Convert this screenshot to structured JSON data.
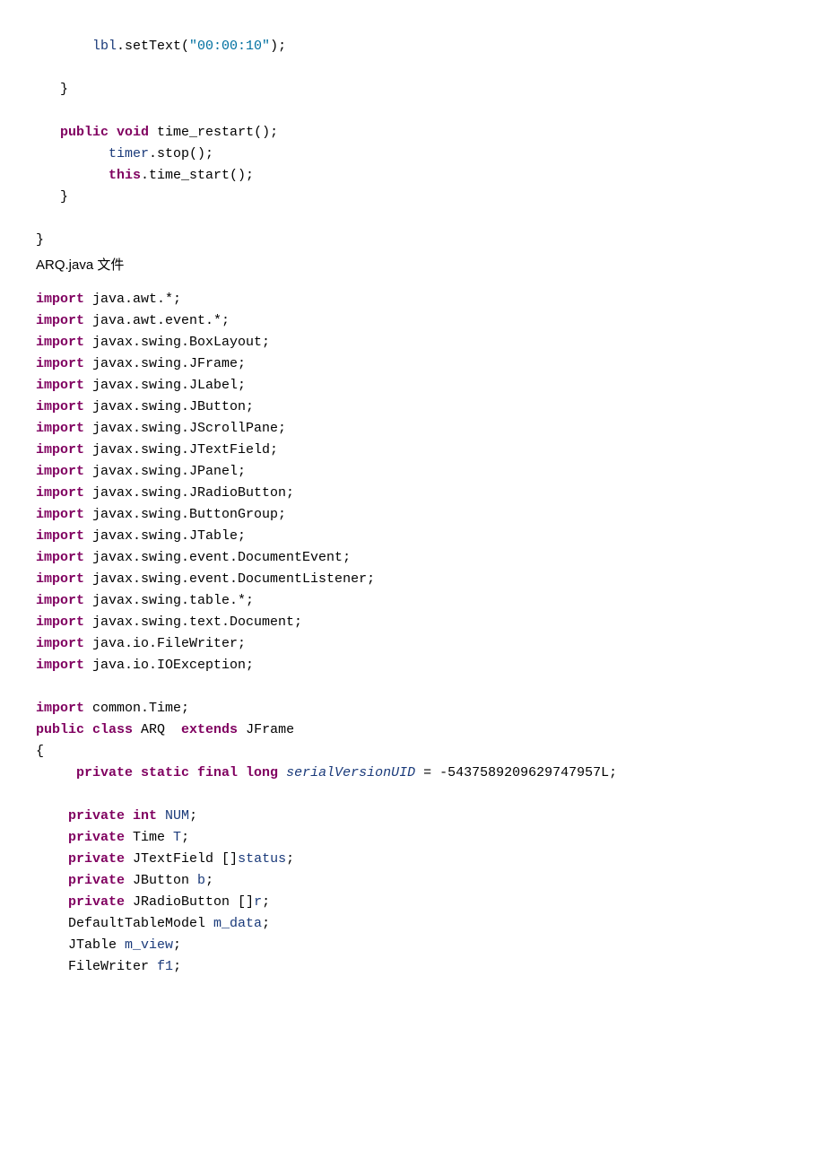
{
  "block1": {
    "l1_part1": "lbl",
    "l1_part2": ".setText(",
    "l1_str": "\"00:00:10\"",
    "l1_part3": ");",
    "l2": "   }",
    "l3_kw": "public void",
    "l3_rest": " time_restart();",
    "l4_fld": "timer",
    "l4_rest": ".stop();",
    "l5_kw": "this",
    "l5_rest": ".time_start();",
    "l6": "   }",
    "l7": "}"
  },
  "caption": "ARQ.java 文件",
  "imports": {
    "kw": "import",
    "i1": " java.awt.*;",
    "i2": " java.awt.event.*;",
    "i3": " javax.swing.BoxLayout;",
    "i4": " javax.swing.JFrame;",
    "i5": " javax.swing.JLabel;",
    "i6": " javax.swing.JButton;",
    "i7": " javax.swing.JScrollPane;",
    "i8": " javax.swing.JTextField;",
    "i9": " javax.swing.JPanel;",
    "i10": " javax.swing.JRadioButton;",
    "i11": " javax.swing.ButtonGroup;",
    "i12": " javax.swing.JTable;",
    "i13": " javax.swing.event.DocumentEvent;",
    "i14": " javax.swing.event.DocumentListener;",
    "i15": " javax.swing.table.*;",
    "i16": " javax.swing.text.Document;",
    "i17": " java.io.FileWriter;",
    "i18": " java.io.IOException;",
    "i19": " common.Time;"
  },
  "cls": {
    "kw1": "public class",
    "name": " ARQ  ",
    "kw2": "extends",
    "ext": " JFrame",
    "brace": "{",
    "svu_kw": "private static final long",
    "svu_name": " serialVersionUID",
    "svu_rest": " = -5437589209629747957L;",
    "f1_kw": "private int",
    "f1_name": " NUM",
    "f1_semi": ";",
    "f2_kw": "private",
    "f2_type": " Time ",
    "f2_name": "T",
    "f2_semi": ";",
    "f3_kw": "private",
    "f3_type": " JTextField []",
    "f3_name": "status",
    "f3_semi": ";",
    "f4_kw": "private",
    "f4_type": " JButton ",
    "f4_name": "b",
    "f4_semi": ";",
    "f5_kw": "private",
    "f5_type": " JRadioButton []",
    "f5_name": "r",
    "f5_semi": ";",
    "f6_type": "DefaultTableModel ",
    "f6_name": "m_data",
    "f6_semi": ";",
    "f7_type": "JTable ",
    "f7_name": "m_view",
    "f7_semi": ";",
    "f8_type": "FileWriter ",
    "f8_name": "f1",
    "f8_semi": ";"
  }
}
